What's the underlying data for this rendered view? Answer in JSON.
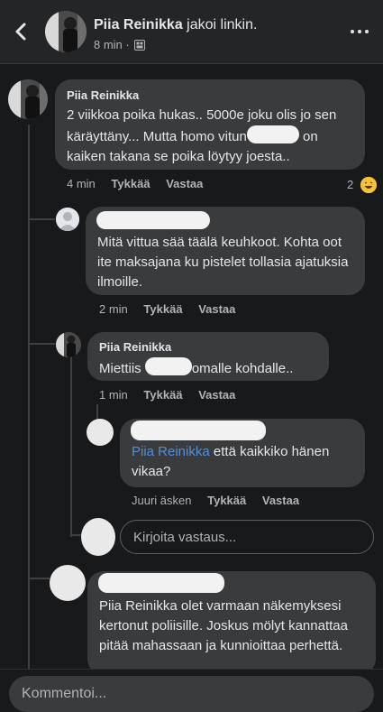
{
  "header": {
    "name": "Piia Reinikka",
    "action": "jakoi linkin.",
    "time": "8 min",
    "separator": "·"
  },
  "comments": [
    {
      "name": "Piia Reinikka",
      "text_part1": "2 viikkoa poika hukas.. 5000e joku olis jo sen käräyttäny... Mutta homo vitun",
      "text_part2": "on kaiken takana se poika löytyy joesta..",
      "time": "4 min",
      "like": "Tykkää",
      "reply": "Vastaa",
      "reaction_count": "2"
    },
    {
      "text": "Mitä vittua sää täälä keuhkoot. Kohta oot ite maksajana ku pistelet tollasia ajatuksia ilmoille.",
      "time": "2 min",
      "like": "Tykkää",
      "reply": "Vastaa"
    },
    {
      "name": "Piia Reinikka",
      "text_part1": "Miettiis",
      "text_part2": "omalle kohdalle..",
      "time": "1 min",
      "like": "Tykkää",
      "reply": "Vastaa"
    },
    {
      "mention": "Piia Reinikka",
      "text": "että kaikkiko hänen vikaa?",
      "time": "Juuri äsken",
      "like": "Tykkää",
      "reply": "Vastaa"
    },
    {
      "text": "Piia Reinikka olet varmaan näkemyksesi kertonut poliisille. Joskus mölyt kannattaa pitää mahassaan ja kunnioittaa perhettä."
    }
  ],
  "reply_input": {
    "placeholder": "Kirjoita vastaus..."
  },
  "comment_input": {
    "placeholder": "Kommentoi..."
  }
}
